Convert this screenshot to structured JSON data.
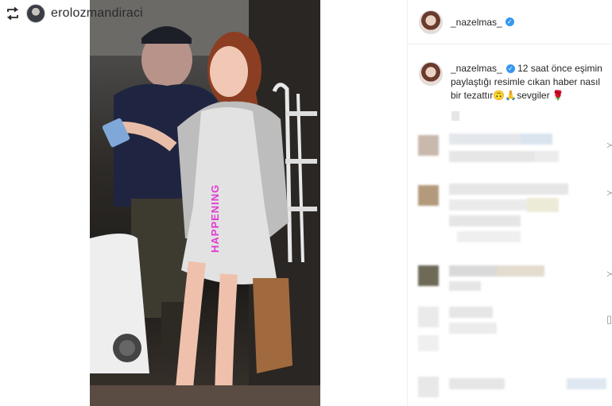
{
  "repost": {
    "icon": "repost-icon",
    "username": "erolozmandiraci"
  },
  "photo": {
    "overlay_text": "HAPPENING",
    "overlay_color": "#e23ad2"
  },
  "panel": {
    "header_username": "_nazelmas_",
    "verified": true,
    "caption": {
      "username": "_nazelmas_",
      "text": "12 saat önce eşimin paylaştığı resimle cıkan haber nasıl bir tezattır🙃🙏sevgiler 🌹"
    }
  },
  "colors": {
    "verified_blue": "#3897f0",
    "border": "#efefef",
    "text": "#262626",
    "muted": "#8e8e8e"
  }
}
